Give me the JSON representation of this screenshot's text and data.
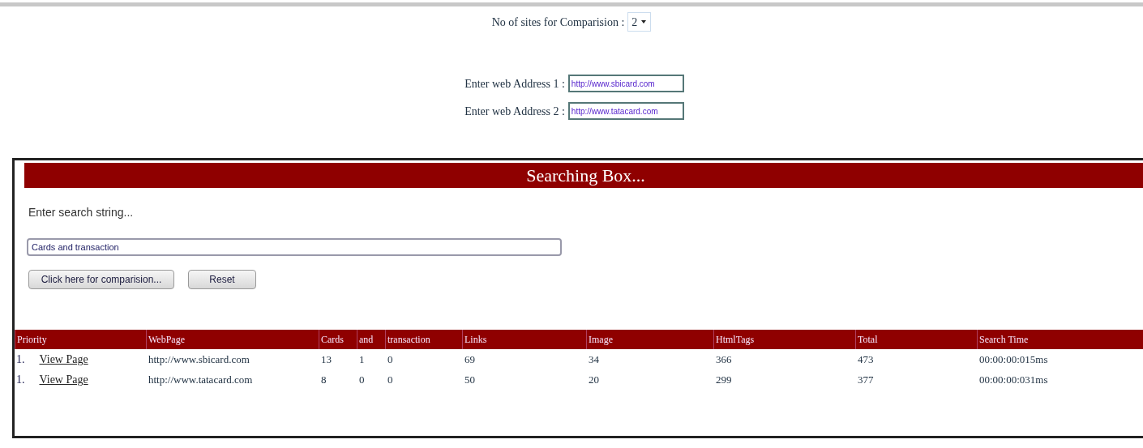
{
  "site_count": {
    "label": "No of sites for Comparision :",
    "value": "2"
  },
  "addresses": [
    {
      "label": "Enter web Address 1 :",
      "value": "http://www.sbicard.com"
    },
    {
      "label": "Enter web Address 2 :",
      "value": "http://www.tatacard.com"
    }
  ],
  "search_box": {
    "title": "Searching Box...",
    "prompt": "Enter search string...",
    "value": "Cards and transaction",
    "buttons": [
      "Click here for comparision...",
      "Reset"
    ]
  },
  "table": {
    "columns": [
      "Priority",
      "WebPage",
      "Cards",
      "and",
      "transaction",
      "Links",
      "Image",
      "HtmlTags",
      "Total",
      "Search Time"
    ],
    "rows": [
      {
        "link": "View Page",
        "cells": [
          "1.",
          "http://www.sbicard.com",
          "13",
          "1",
          "0",
          "69",
          "34",
          "366",
          "473",
          "00:00:00:015ms"
        ]
      },
      {
        "link": "View Page",
        "cells": [
          "1.",
          "http://www.tatacard.com",
          "8",
          "0",
          "0",
          "50",
          "20",
          "299",
          "377",
          "00:00:00:031ms"
        ]
      }
    ]
  }
}
